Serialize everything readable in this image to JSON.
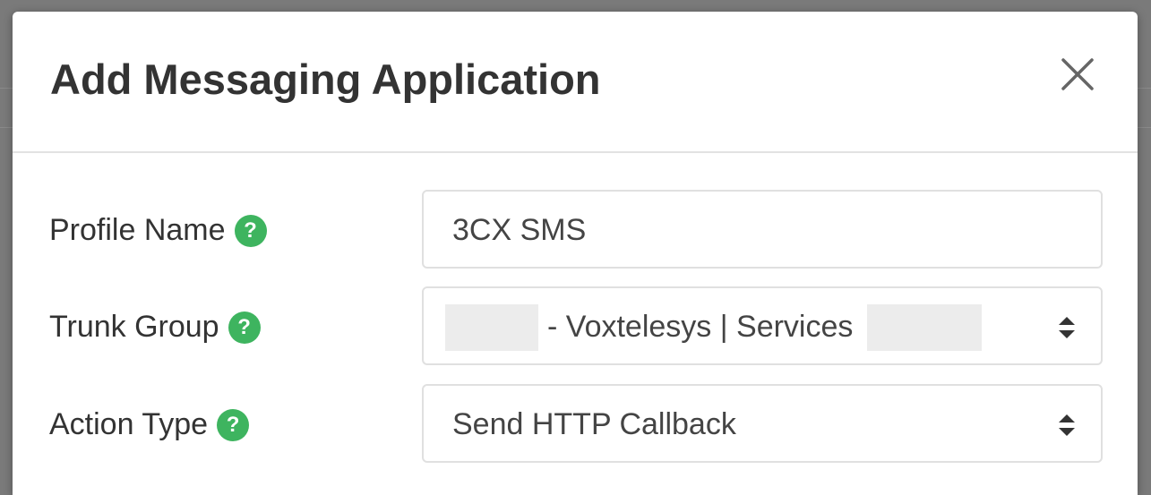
{
  "modal": {
    "title": "Add Messaging Application",
    "close_icon": "close-x-icon"
  },
  "form": {
    "profile_name": {
      "label": "Profile Name",
      "value": "3CX SMS",
      "help_icon": "help-question-icon"
    },
    "trunk_group": {
      "label": "Trunk Group",
      "value": "- Voxtelesys | Services",
      "help_icon": "help-question-icon"
    },
    "action_type": {
      "label": "Action Type",
      "value": "Send HTTP Callback",
      "help_icon": "help-question-icon"
    }
  },
  "colors": {
    "help_icon_green": "#3eb45f",
    "field_border": "#e0e0e0",
    "text": "#333333"
  }
}
